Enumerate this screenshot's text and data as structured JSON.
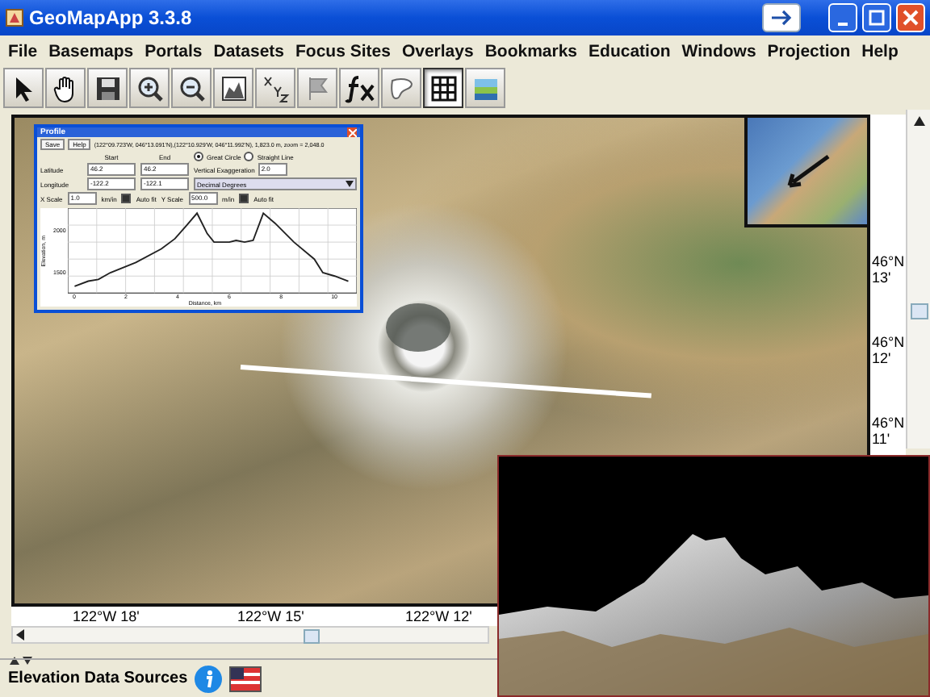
{
  "window": {
    "title": "GeoMapApp 3.3.8"
  },
  "menu": [
    "File",
    "Basemaps",
    "Portals",
    "Datasets",
    "Focus Sites",
    "Overlays",
    "Bookmarks",
    "Education",
    "Windows",
    "Projection",
    "Help"
  ],
  "toolbar": [
    {
      "kind": "pointer",
      "selected": false
    },
    {
      "kind": "hand",
      "selected": false
    },
    {
      "kind": "save",
      "selected": false
    },
    {
      "kind": "zoom-in",
      "selected": false
    },
    {
      "kind": "zoom-out",
      "selected": false
    },
    {
      "kind": "profile",
      "selected": false
    },
    {
      "kind": "xyz",
      "selected": false
    },
    {
      "kind": "flag",
      "selected": false
    },
    {
      "kind": "fx",
      "selected": false
    },
    {
      "kind": "contour",
      "selected": false
    },
    {
      "kind": "grid",
      "selected": true
    },
    {
      "kind": "layers",
      "selected": false
    }
  ],
  "map": {
    "lat_labels": [
      {
        "degrees": "46°N",
        "minutes": "13'"
      },
      {
        "degrees": "46°N",
        "minutes": "12'"
      },
      {
        "degrees": "46°N",
        "minutes": "11'"
      }
    ],
    "lon_labels": [
      "122°W 18'",
      "122°W 15'",
      "122°W 12'"
    ]
  },
  "profile": {
    "title": "Profile",
    "buttons": [
      "Save",
      "Help"
    ],
    "info": "(122°09.723'W, 046°13.091'N),(122°10.929'W, 046°11.992'N), 1,823.0 m, zoom = 2,048.0",
    "start_label": "Start",
    "end_label": "End",
    "latitude_label": "Latitude",
    "longitude_label": "Longitude",
    "start_lat": "46.2",
    "end_lat": "46.2",
    "start_lon": "-122.2",
    "end_lon": "-122.1",
    "options": [
      {
        "label": "Great Circle",
        "selected": true
      },
      {
        "label": "Straight Line",
        "selected": false
      }
    ],
    "exaggeration_label": "Vertical Exaggeration",
    "exaggeration": "2.0",
    "format": "Decimal Degrees",
    "x_scale_label": "X Scale",
    "x_scale": "1.0",
    "x_units": "km/in",
    "x_autofit": {
      "label": "Auto fit",
      "checked": true
    },
    "y_scale_label": "Y Scale",
    "y_scale": "500.0",
    "y_units": "m/in",
    "y_autofit": {
      "label": "Auto fit",
      "checked": true
    },
    "x_ticks": [
      "0",
      "2",
      "4",
      "6",
      "8",
      "10"
    ],
    "y_ticks": [
      "2000",
      "1500"
    ],
    "xlabel": "Distance, km",
    "ylabel": "Elevation, m"
  },
  "status_bar": {
    "label": "Elevation Data Sources"
  }
}
